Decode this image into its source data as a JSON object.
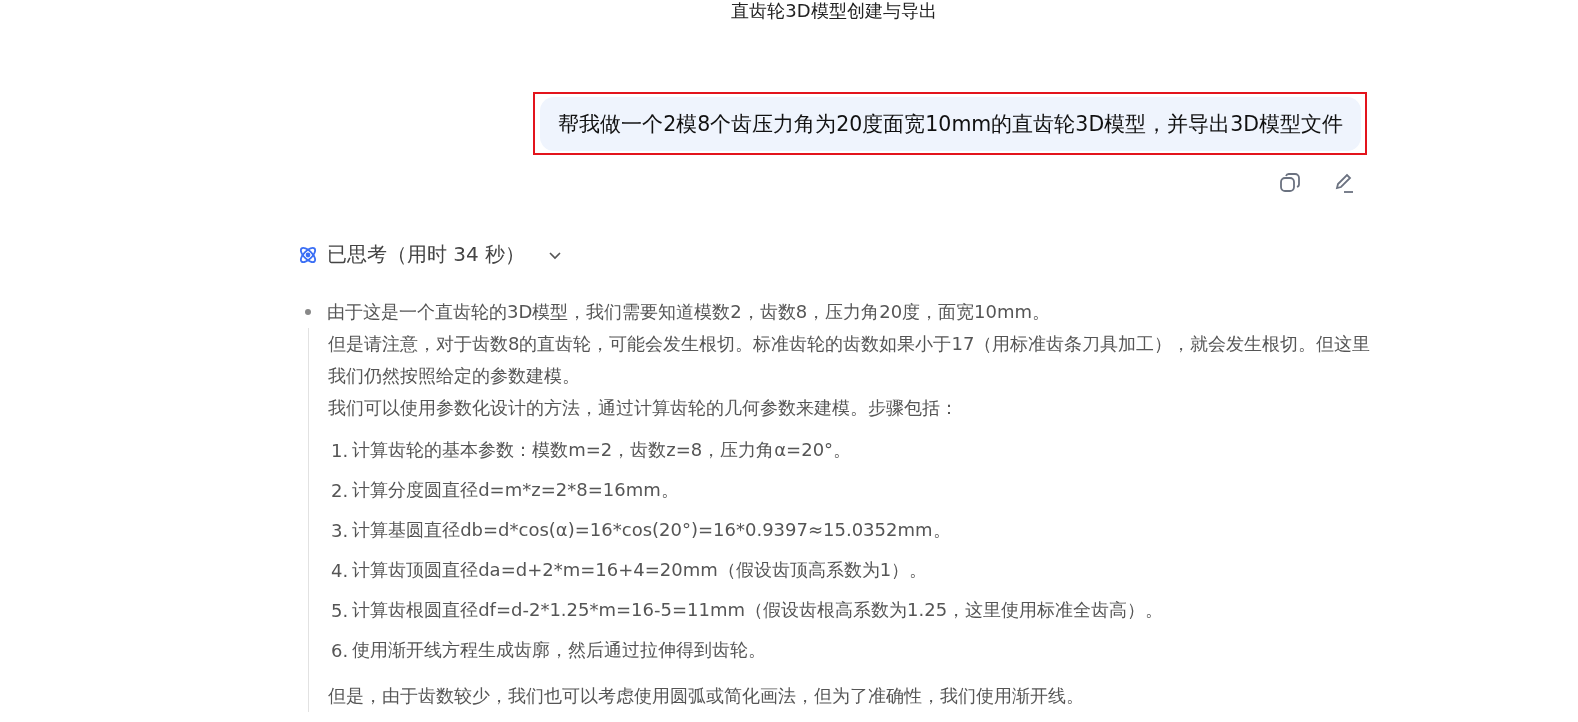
{
  "conversation_title": "直齿轮3D模型创建与导出",
  "user_message": {
    "text": "帮我做一个2模8个齿压力角为20度面宽10mm的直齿轮3D模型，并导出3D模型文件",
    "highlighted": true
  },
  "thinking": {
    "label": "已思考（用时 34 秒）",
    "expanded": true,
    "lead": "由于这是一个直齿轮的3D模型，我们需要知道模数2，齿数8，压力角20度，面宽10mm。",
    "paragraphs": [
      "但是请注意，对于齿数8的直齿轮，可能会发生根切。标准齿轮的齿数如果小于17（用标准齿条刀具加工），就会发生根切。但这里我们仍然按照给定的参数建模。",
      "我们可以使用参数化设计的方法，通过计算齿轮的几何参数来建模。步骤包括："
    ],
    "steps": [
      "计算齿轮的基本参数：模数m=2，齿数z=8，压力角α=20°。",
      "计算分度圆直径d=m*z=2*8=16mm。",
      "计算基圆直径db=d*cos(α)=16*cos(20°)=16*0.9397≈15.0352mm。",
      "计算齿顶圆直径da=d+2*m=16+4=20mm（假设齿顶高系数为1）。",
      "计算齿根圆直径df=d-2*1.25*m=16-5=11mm（假设齿根高系数为1.25，这里使用标准全齿高）。",
      "使用渐开线方程生成齿廓，然后通过拉伸得到齿轮。"
    ],
    "step_numbers": [
      "1.",
      "2.",
      "3.",
      "4.",
      "5.",
      "6."
    ],
    "after": "但是，由于齿数较少，我们也可以考虑使用圆弧或简化画法，但为了准确性，我们使用渐开线。"
  }
}
